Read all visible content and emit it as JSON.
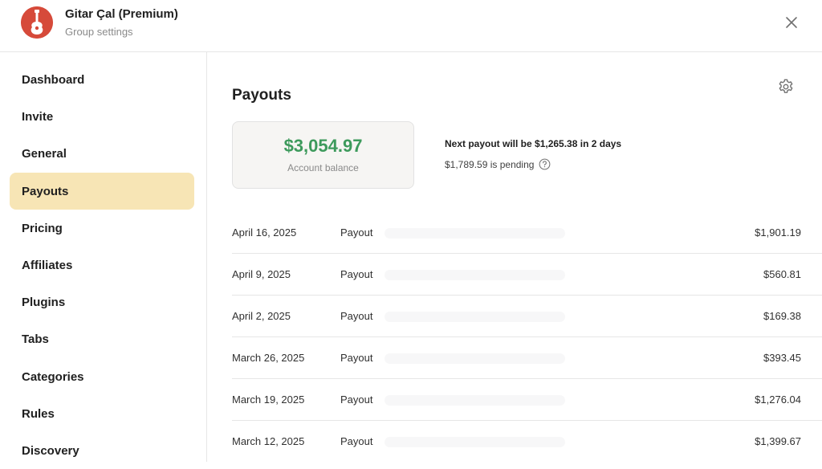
{
  "header": {
    "group_name": "Gitar Çal (Premium)",
    "subtitle": "Group settings"
  },
  "icons": {
    "avatar": "guitar-logo",
    "close": "close-icon",
    "settings": "gear-icon",
    "help": "question-circle-icon"
  },
  "sidebar": {
    "items": [
      {
        "label": "Dashboard",
        "active": false
      },
      {
        "label": "Invite",
        "active": false
      },
      {
        "label": "General",
        "active": false
      },
      {
        "label": "Payouts",
        "active": true
      },
      {
        "label": "Pricing",
        "active": false
      },
      {
        "label": "Affiliates",
        "active": false
      },
      {
        "label": "Plugins",
        "active": false
      },
      {
        "label": "Tabs",
        "active": false
      },
      {
        "label": "Categories",
        "active": false
      },
      {
        "label": "Rules",
        "active": false
      },
      {
        "label": "Discovery",
        "active": false
      }
    ]
  },
  "main": {
    "title": "Payouts",
    "balance": {
      "amount": "$3,054.97",
      "label": "Account balance"
    },
    "next_payout": "Next payout will be $1,265.38 in 2 days",
    "pending": "$1,789.59 is pending",
    "payouts": [
      {
        "date": "April 16, 2025",
        "type": "Payout",
        "amount": "$1,901.19"
      },
      {
        "date": "April 9, 2025",
        "type": "Payout",
        "amount": "$560.81"
      },
      {
        "date": "April 2, 2025",
        "type": "Payout",
        "amount": "$169.38"
      },
      {
        "date": "March 26, 2025",
        "type": "Payout",
        "amount": "$393.45"
      },
      {
        "date": "March 19, 2025",
        "type": "Payout",
        "amount": "$1,276.04"
      },
      {
        "date": "March 12, 2025",
        "type": "Payout",
        "amount": "$1,399.67"
      }
    ]
  },
  "colors": {
    "accent_active": "#f7e5b5",
    "balance_green": "#3d9a5c",
    "avatar_red": "#d64a3a"
  }
}
